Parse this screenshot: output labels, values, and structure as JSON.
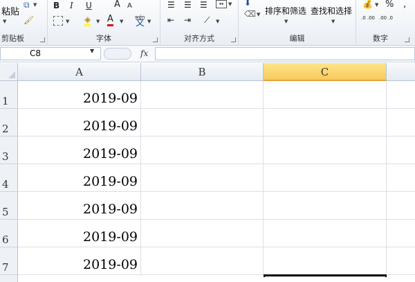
{
  "ribbon": {
    "clipboard": {
      "paste_label": "粘贴",
      "group_label": "剪贴板"
    },
    "font": {
      "group_label": "字体",
      "bold": "B",
      "italic": "I",
      "grow": "A",
      "shrink": "A",
      "font_color_glyph": "A",
      "phonetic_glyph": "文",
      "phonetic_top": "wén"
    },
    "alignment": {
      "group_label": "对齐方式"
    },
    "editing": {
      "sort_filter_label": "排序和筛选",
      "find_select_label": "查找和选择",
      "group_label": "编辑"
    },
    "number": {
      "group_label": "数字",
      "percent": "%",
      "comma": ",",
      "inc_decimal": ".0 .00",
      "dec_decimal": ".00 .0"
    }
  },
  "formula_bar": {
    "name_box": "C8",
    "fx_label": "fx",
    "formula": ""
  },
  "columns": [
    "A",
    "B",
    "C"
  ],
  "selected_column": "C",
  "rows": [
    {
      "num": "1",
      "a": "2019-09"
    },
    {
      "num": "2",
      "a": "2019-09"
    },
    {
      "num": "3",
      "a": "2019-09"
    },
    {
      "num": "4",
      "a": "2019-09"
    },
    {
      "num": "5",
      "a": "2019-09"
    },
    {
      "num": "6",
      "a": "2019-09"
    },
    {
      "num": "7",
      "a": "2019-09"
    }
  ],
  "colors": {
    "selected_header": "#f8c95a",
    "grid_line": "#dadfe6",
    "header_bg": "#eef2f7"
  }
}
